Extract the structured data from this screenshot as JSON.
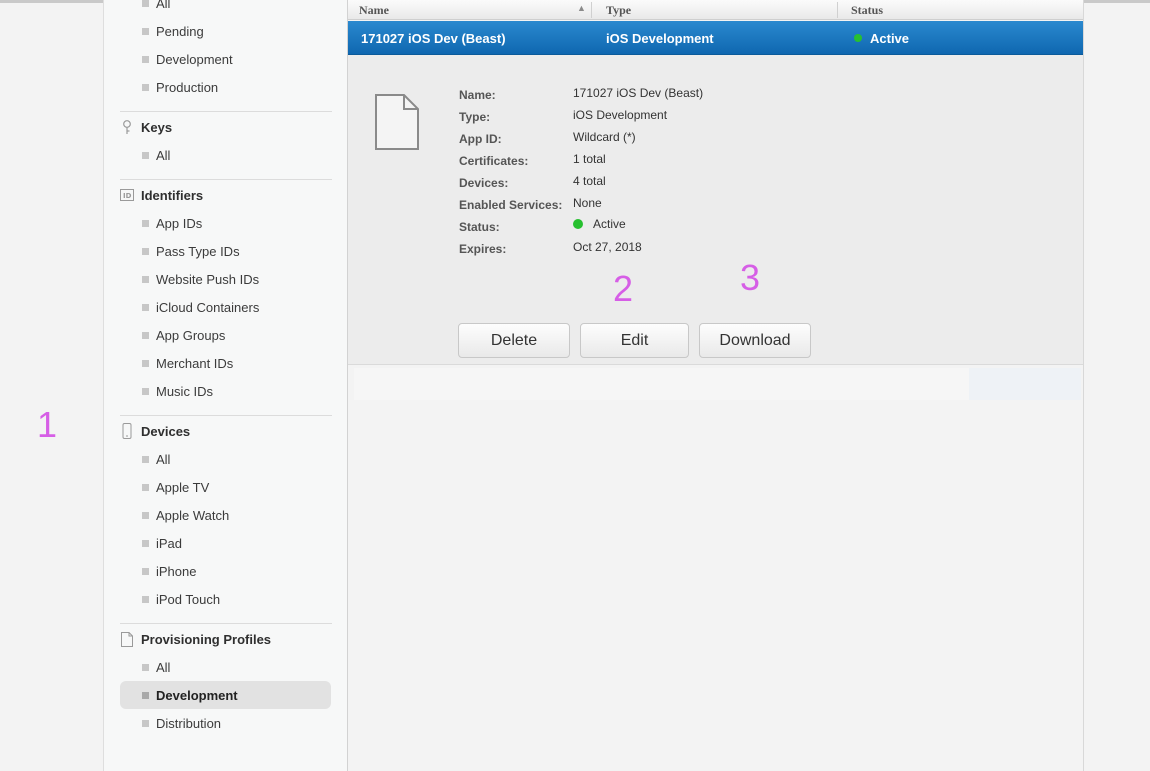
{
  "annotations": [
    "1",
    "2",
    "3"
  ],
  "sidebar": {
    "top_items": [
      "All",
      "Pending",
      "Development",
      "Production"
    ],
    "sections": [
      {
        "title": "Keys",
        "icon": "key-icon",
        "items": [
          "All"
        ]
      },
      {
        "title": "Identifiers",
        "icon": "id-icon",
        "items": [
          "App IDs",
          "Pass Type IDs",
          "Website Push IDs",
          "iCloud Containers",
          "App Groups",
          "Merchant IDs",
          "Music IDs"
        ]
      },
      {
        "title": "Devices",
        "icon": "device-icon",
        "items": [
          "All",
          "Apple TV",
          "Apple Watch",
          "iPad",
          "iPhone",
          "iPod Touch"
        ]
      },
      {
        "title": "Provisioning Profiles",
        "icon": "document-icon",
        "items": [
          "All",
          "Development",
          "Distribution"
        ]
      }
    ],
    "selected_item": "Development"
  },
  "table": {
    "columns": [
      "Name",
      "Type",
      "Status"
    ],
    "selected_row": {
      "name": "171027 iOS Dev (Beast)",
      "type": "iOS Development",
      "status": "Active"
    }
  },
  "detail": {
    "labels": [
      "Name:",
      "Type:",
      "App ID:",
      "Certificates:",
      "Devices:",
      "Enabled Services:",
      "Status:",
      "Expires:"
    ],
    "values": [
      "171027 iOS Dev (Beast)",
      "iOS Development",
      "Wildcard (*)",
      "1 total",
      "4 total",
      "None",
      "Active",
      "Oct 27, 2018"
    ]
  },
  "buttons": {
    "delete": "Delete",
    "edit": "Edit",
    "download": "Download"
  },
  "colors": {
    "selection": "#1a76bf",
    "active_status": "#27c02f",
    "annotation": "#d65ee6"
  }
}
